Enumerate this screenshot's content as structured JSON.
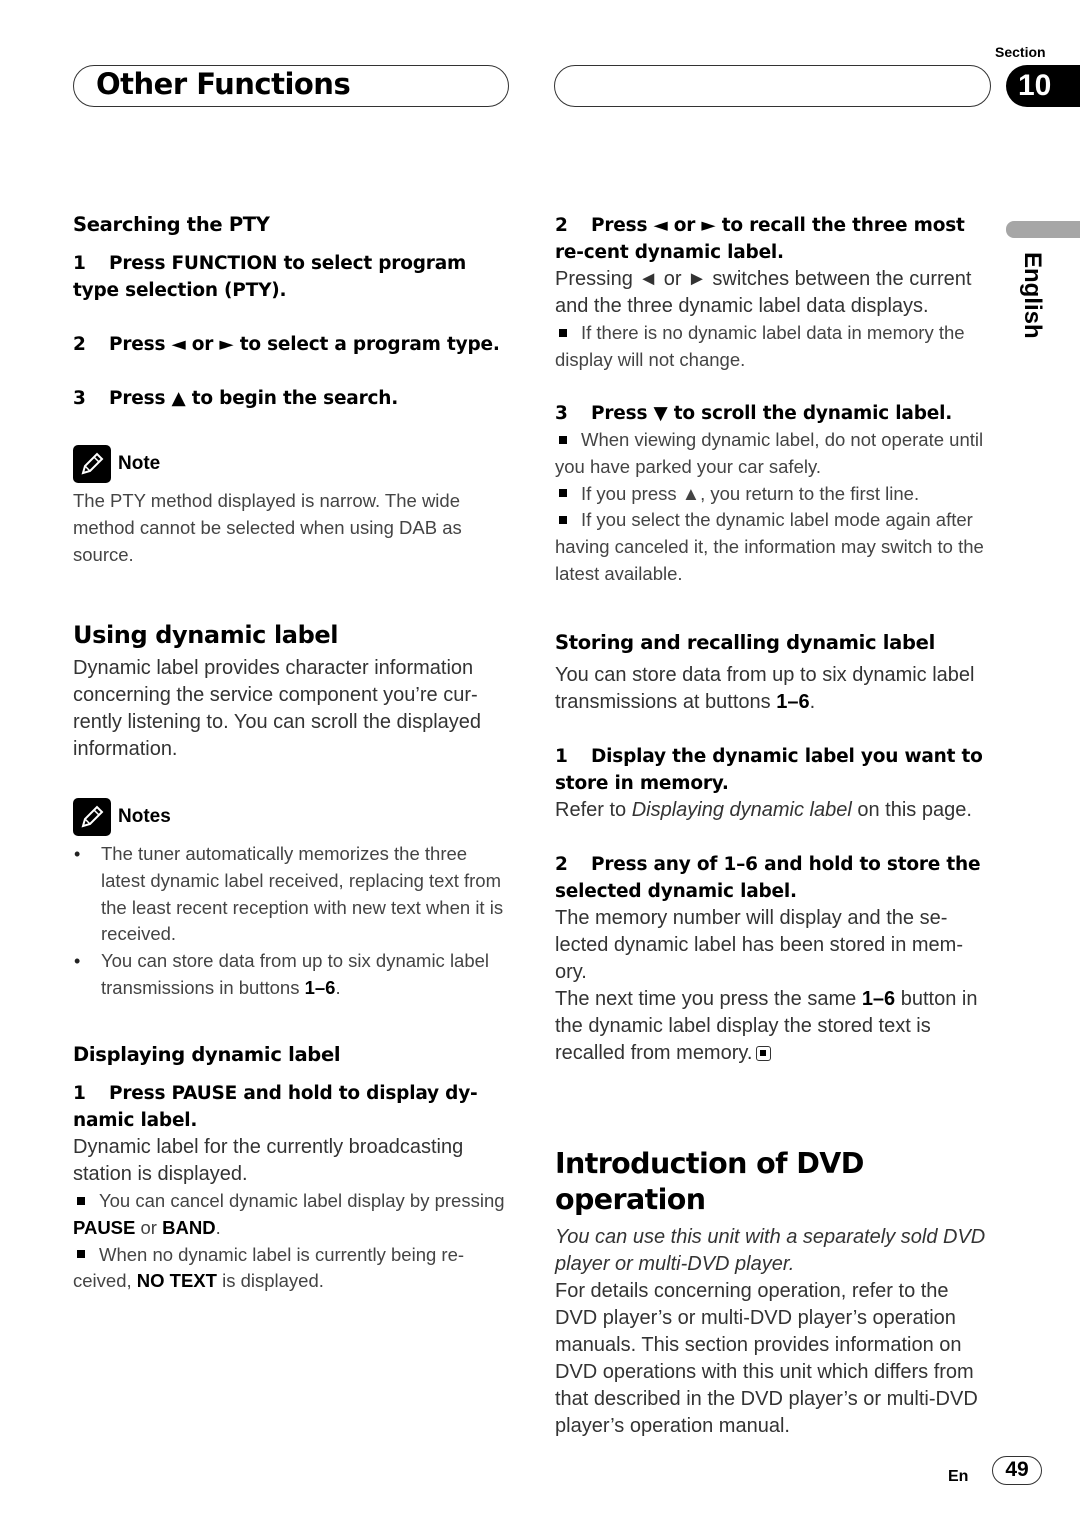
{
  "header": {
    "chapter_title": "Other Functions",
    "section_label": "Section",
    "section_number": "10",
    "language_tab": "English"
  },
  "left": {
    "searching_pty": {
      "heading": "Searching the PTY",
      "steps": [
        {
          "num": "1",
          "text": "Press FUNCTION to select program type selection (PTY)."
        },
        {
          "num": "2",
          "text": "Press ◄ or ► to select a program type."
        },
        {
          "num": "3",
          "text": "Press ▲ to begin the search."
        }
      ],
      "note": {
        "title": "Note",
        "icon": "pencil-icon",
        "text": "The PTY method displayed is narrow. The wide method cannot be selected when using DAB as source."
      }
    },
    "using_dynamic_label": {
      "heading": "Using dynamic label",
      "body": "Dynamic label provides character information concerning the service component you’re cur-rently listening to. You can scroll the displayed information.",
      "notes": {
        "title": "Notes",
        "icon": "pencil-icon",
        "items": [
          {
            "text": "The tuner automatically memorizes the three latest dynamic label received, replacing text from the least recent reception with new text when it is received."
          },
          {
            "text": "You can store data from up to six dynamic label transmissions in buttons ",
            "bold": "1–6",
            "tail": "."
          }
        ]
      }
    },
    "displaying_dynamic_label": {
      "heading": "Displaying dynamic label",
      "step1": {
        "num": "1",
        "text": "Press PAUSE and hold to display dy-namic label."
      },
      "body": "Dynamic label for the currently broadcasting station is displayed.",
      "bullet1": {
        "pre": "You can cancel dynamic label display by pressing ",
        "b1": "PAUSE",
        "mid": " or ",
        "b2": "BAND",
        "tail": "."
      },
      "bullet2": {
        "pre": "When no dynamic label is currently being re-ceived, ",
        "b1": "NO TEXT",
        "tail": " is displayed."
      }
    }
  },
  "right": {
    "step2": {
      "num": "2",
      "text": "Press ◄ or ► to recall the three most re-cent dynamic label."
    },
    "step2_body": "Pressing ◄ or ► switches between the current and the three dynamic label data displays.",
    "step2_bullet": "If there is no dynamic label data in memory the display will not change.",
    "step3": {
      "num": "3",
      "text": "Press ▼ to scroll the dynamic label."
    },
    "step3_bullets": [
      "When viewing dynamic label, do not operate until you have parked your car safely.",
      "If you press ▲, you return to the first line.",
      "If you select the dynamic label mode again after having canceled it, the information may switch to the latest available."
    ],
    "storing": {
      "heading": "Storing and recalling dynamic label",
      "intro_pre": "You can store data from up to six dynamic label transmissions at buttons ",
      "intro_bold": "1–6",
      "intro_tail": ".",
      "step1": {
        "num": "1",
        "text": "Display the dynamic label you want to store in memory."
      },
      "step1_pre": "Refer to ",
      "step1_ital": "Displaying dynamic label",
      "step1_tail": " on this page.",
      "step2": {
        "num": "2",
        "text": "Press any of 1–6 and hold to store the selected dynamic label."
      },
      "step2_body": "The memory number will display and the se-lected dynamic label has been stored in mem-ory.",
      "step2_body2_pre": "The next time you press the same ",
      "step2_body2_bold": "1–6",
      "step2_body2_tail": " button in the dynamic label display the stored text is recalled from memory.",
      "end_icon": "end-of-section-icon"
    },
    "dvd": {
      "heading": "Introduction of DVD operation",
      "lead": "You can use this unit with a separately sold DVD player or multi-DVD player.",
      "body": "For details concerning operation, refer to the DVD player’s or multi-DVD player’s operation manuals. This section provides information on DVD operations with this unit which differs from that described in the DVD player’s or multi-DVD player’s operation manual."
    }
  },
  "footer": {
    "lang_code": "En",
    "page_number": "49"
  }
}
